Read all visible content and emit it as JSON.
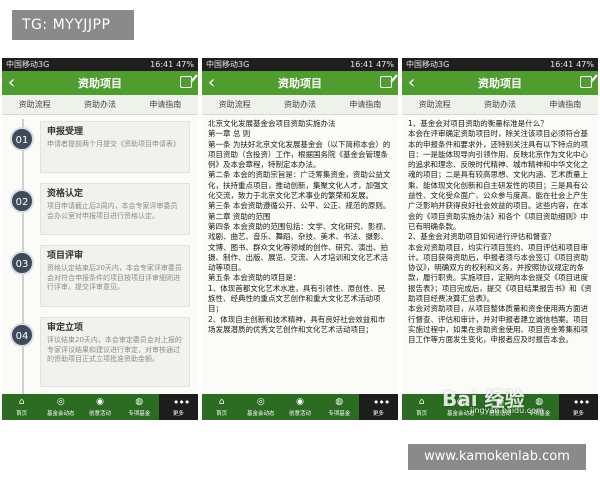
{
  "tg_label": "TG: MYYJJPP",
  "footer_url": "www.kamokenlab.com",
  "watermark": "Bai 经验",
  "watermark_sub": "jingyan.baidu.com",
  "status": {
    "carrier": "中国移动3G",
    "time": "16:41",
    "battery": "47%"
  },
  "nav_title": "资助项目",
  "tabs": [
    "资助流程",
    "资助办法",
    "申请指南"
  ],
  "bottom_nav": [
    "首页",
    "基金会动态",
    "创意活动",
    "专项基金",
    "更多"
  ],
  "steps": [
    {
      "num": "01",
      "title": "申报受理",
      "desc": "申请者提前两个月提交《资助项目申请表》"
    },
    {
      "num": "02",
      "title": "资格认定",
      "desc": "项目申请截止后2周内，本会专家评审委员会办公室对申报项目进行资格认定。"
    },
    {
      "num": "03",
      "title": "项目评审",
      "desc": "资格认定结束后20天内，本会专家评审委员会对符合申报条件的项目按项目评审细则进行评审。提交评审意见。"
    },
    {
      "num": "04",
      "title": "审定立项",
      "desc": "评议结束20天内，本会审定委员会对上报的专家评议结果和建议进行审定，对审核通过的资助项目正式立项批准资助金额。"
    }
  ],
  "screen2_lines": [
    "北京文化发展基金会项目资助实施办法",
    "第一章 总 则",
    "第一条 为扶好北京文化发展基金会（以下简称本会）的项目资助（含投资）工作，根据国务院《基金会管理条例》及本会章程，特制定本办法。",
    "第二条 本会的资助宗旨是：广泛筹集资金，资助公益文化，扶持重点项目，推动创新，集聚文化人才，加强文化交流，致力于北京文化艺术事业的繁荣和发展。",
    "第三条 本会资助遵循公开、公平、公正、规范的原则。",
    "第二章 资助的范围",
    "第四条 本会资助的范围包括：文学、文化研究、影视、戏剧、曲艺、音乐、舞蹈、杂技、美术、书法、摄影、文博、图书、群众文化等领域的创作、研究、演出、拍摄、制作、出版、展览、交流、人才培训和文化艺术活动等项目。",
    "第五条 本会资助的项目是：",
    "1、体现首都文化艺术水准，具有引领性、原创性、民族性、经典性的重点文艺创作和重大文化艺术活动项目；",
    "2、体现自主创新和技术精神，具有良好社会效益和市场发展潜质的优秀文艺创作和文化艺术活动项目；"
  ],
  "screen3_lines": [
    "1、基金会对项目资助的衡量标准是什么？",
    "本会在评审确定资助项目时，除关注该项目必须符合基本的申报条件和要求外，还特别关注具有以下特点的项目：一是能体现导向引领作用、反映北京作为文化中心的追求和理念、反映时代精神、城市精神和中华文化之魂的项目；二是具有较高思想、文化内涵、艺术质量上乘、能体现文化创新和自主研发性的项目；三是具有公益性、文化受众面广、公众参与度高、能在社会上产生广泛影响并获得良好社会效益的项目。这些内容，在本会的《项目资助实施办法》和各个《项目资助细则》中已有明确条款。",
    "2、基金会对资助项目如何进行评估和督查？",
    "本会对资助项目，均实行项目签约、项目评估和项目审计。项目获得资助后，申报者须与本会签订《项目资助协议》，明确双方的权利和义务，并按照协议规定的条款，履行职责。实施项目，定期向本会提交《项目进度报告表》；项目完成后，提交《项目结果报告书》和《资助项目经费决算汇总表》。",
    "本会对资助项目，从项目整体质量和资金使用两方面进行督查、评估和审计，并对申报者建立诚信档案。项目实施过程中，如果在资助资金使用、项目资金筹集和项目工作等方面发生变化，申报者应及时报告本会。"
  ]
}
